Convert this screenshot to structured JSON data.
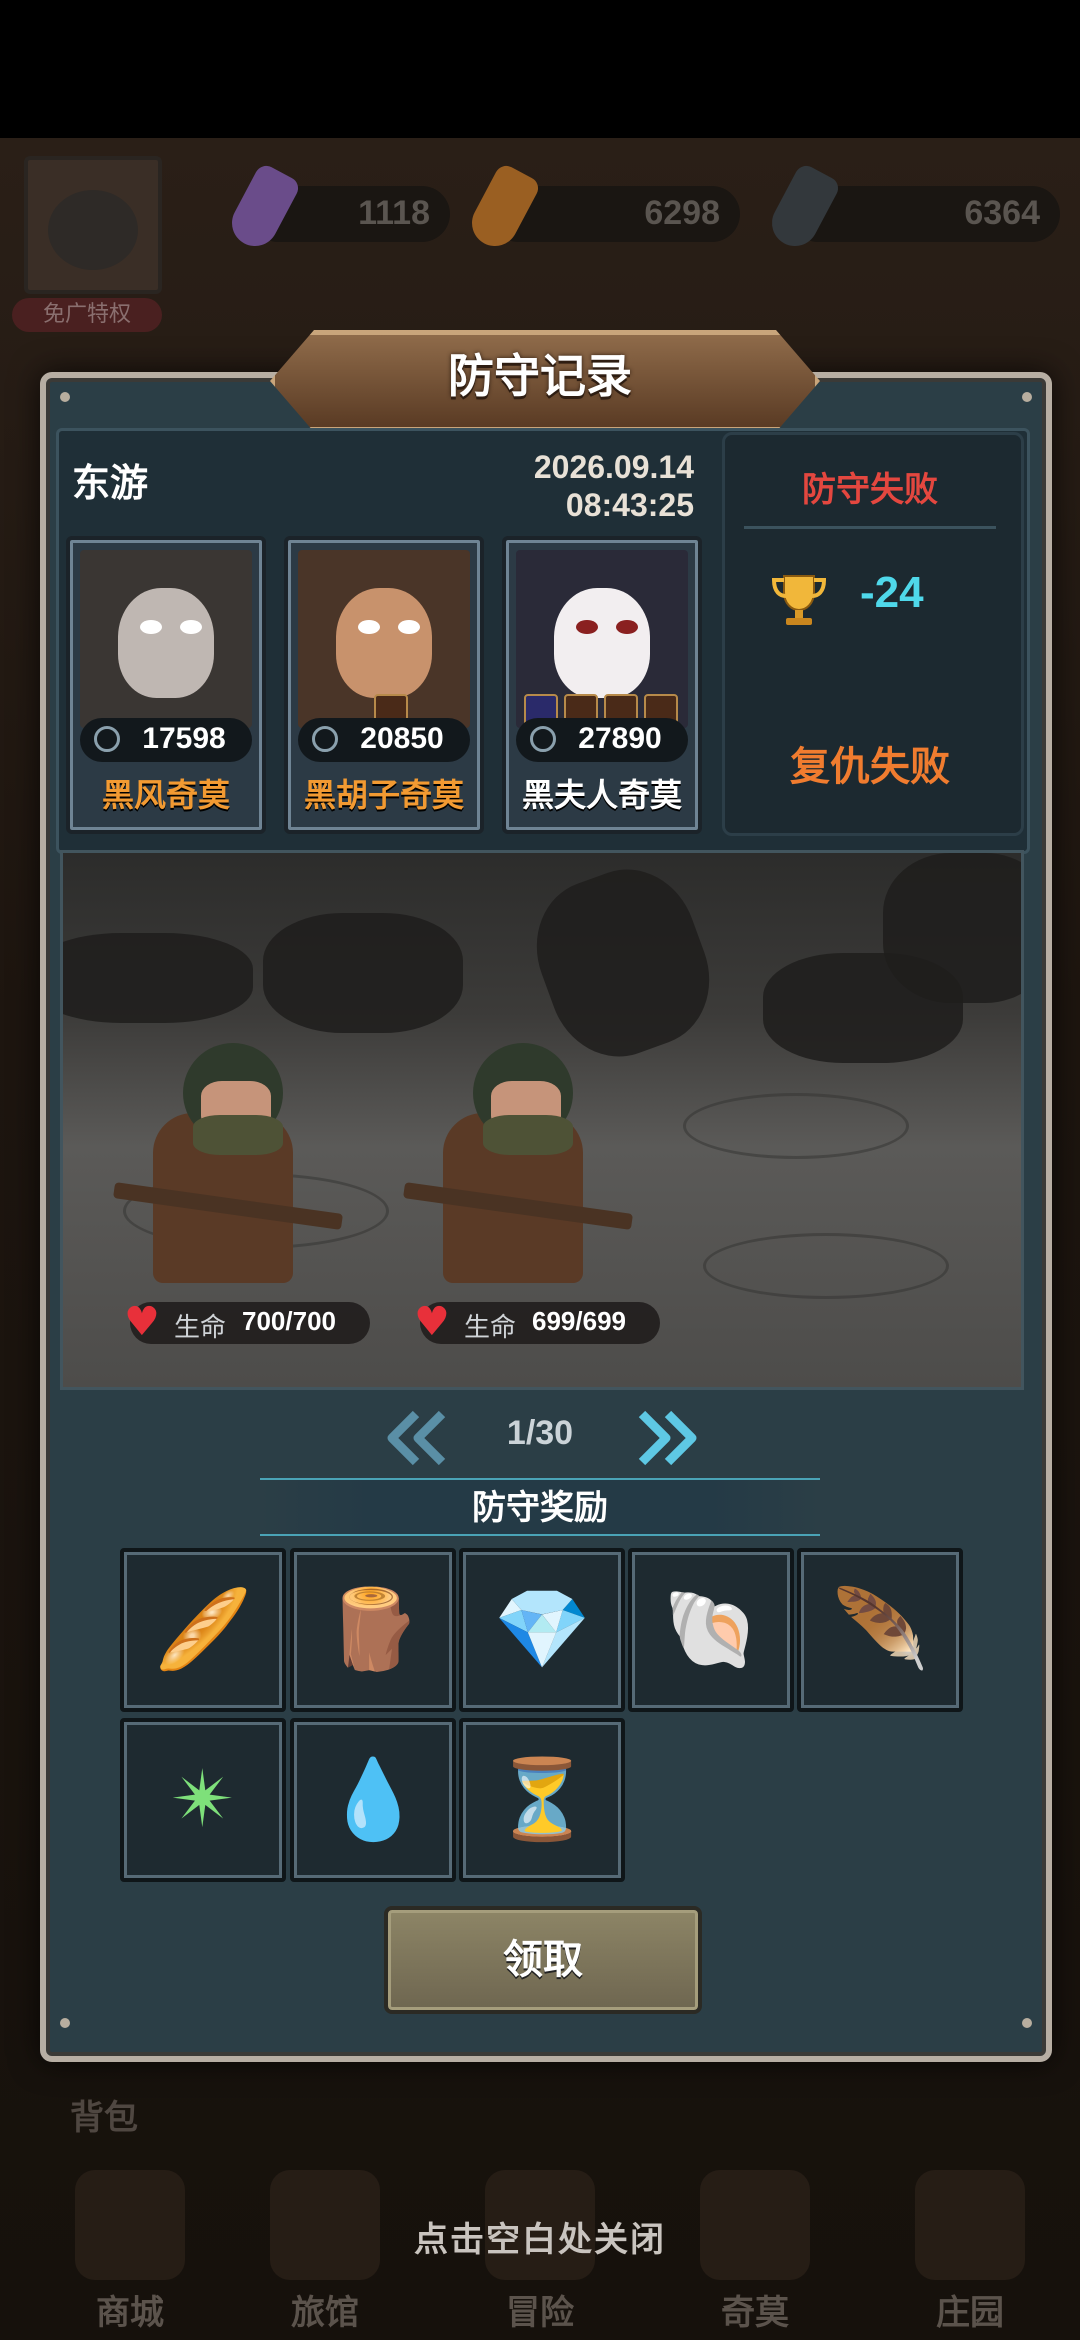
{
  "background": {
    "resources": [
      {
        "name": "rainbow-carrot",
        "value": "1118",
        "color": "#7a5aa8"
      },
      {
        "name": "orange-carrot",
        "value": "6298",
        "color": "#c47a2c"
      },
      {
        "name": "dark-carrot",
        "value": "6364",
        "color": "#444a50"
      }
    ],
    "ad_free_label": "免广特权",
    "backpack_label": "背包",
    "nav": [
      {
        "label": "商城",
        "icon": "shop-icon"
      },
      {
        "label": "旅馆",
        "icon": "inn-icon"
      },
      {
        "label": "冒险",
        "icon": "adventure-icon"
      },
      {
        "label": "奇莫",
        "icon": "qimo-icon"
      },
      {
        "label": "庄园",
        "icon": "manor-icon"
      }
    ],
    "close_hint": "点击空白处关闭"
  },
  "dialog": {
    "title": "防守记录",
    "opponent": "东游",
    "date": "2026.09.14",
    "time": "08:43:25",
    "heroes": [
      {
        "name": "黑风奇莫",
        "power": "17598",
        "name_color": "#f29a32",
        "bg": "#3a3633",
        "skin": "#bfb7b2"
      },
      {
        "name": "黑胡子奇莫",
        "power": "20850",
        "name_color": "#f29a32",
        "bg": "#4a3528",
        "skin": "#c8926c"
      },
      {
        "name": "黑夫人奇莫",
        "power": "27890",
        "name_color": "#ffffff",
        "bg": "#2a2a38",
        "skin": "#f2eef0"
      }
    ],
    "result": "防守失败",
    "score_change": "-24",
    "revenge": "复仇失败",
    "defenders": [
      {
        "hp_label": "生命",
        "hp": "700/700"
      },
      {
        "hp_label": "生命",
        "hp": "699/699"
      }
    ],
    "page": "1/30",
    "reward_title": "防守奖励",
    "rewards": [
      {
        "name": "bread-icon",
        "glyph": "🥖"
      },
      {
        "name": "wood-icon",
        "glyph": "🪵"
      },
      {
        "name": "blue-crystal-icon",
        "glyph": "💎"
      },
      {
        "name": "pink-shell-icon",
        "glyph": "🐚"
      },
      {
        "name": "feather-icon",
        "glyph": "🪶"
      },
      {
        "name": "star-burst-icon",
        "glyph": "✴"
      },
      {
        "name": "diamond-drop-icon",
        "glyph": "💧"
      },
      {
        "name": "hourglass-icon",
        "glyph": "⏳"
      }
    ],
    "claim_label": "领取"
  },
  "colors": {
    "fail_red": "#e4473f",
    "score_cyan": "#4fd8ea",
    "revenge_orange": "#f07c2f",
    "hero_orange": "#f29a32"
  }
}
